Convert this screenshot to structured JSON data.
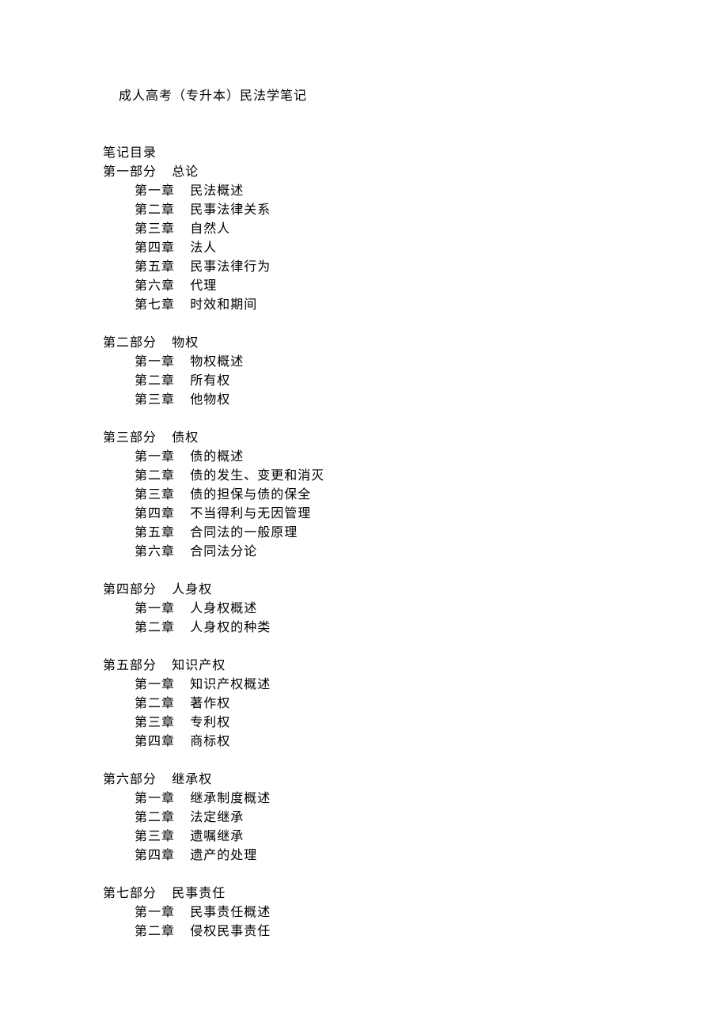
{
  "title": "成人高考（专升本）民法学笔记",
  "toc_header": "笔记目录",
  "parts": [
    {
      "label": "第一部分",
      "name": "总论",
      "chapters": [
        {
          "label": "第一章",
          "name": "民法概述"
        },
        {
          "label": "第二章",
          "name": "民事法律关系"
        },
        {
          "label": "第三章",
          "name": "自然人"
        },
        {
          "label": "第四章",
          "name": "法人"
        },
        {
          "label": "第五章",
          "name": "民事法律行为"
        },
        {
          "label": "第六章",
          "name": "代理"
        },
        {
          "label": "第七章",
          "name": "时效和期间"
        }
      ]
    },
    {
      "label": "第二部分",
      "name": "物权",
      "chapters": [
        {
          "label": "第一章",
          "name": "物权概述"
        },
        {
          "label": "第二章",
          "name": "所有权"
        },
        {
          "label": "第三章",
          "name": "他物权"
        }
      ]
    },
    {
      "label": "第三部分",
      "name": "债权",
      "chapters": [
        {
          "label": "第一章",
          "name": "债的概述"
        },
        {
          "label": "第二章",
          "name": "债的发生、变更和消灭"
        },
        {
          "label": "第三章",
          "name": "债的担保与债的保全"
        },
        {
          "label": "第四章",
          "name": "不当得利与无因管理"
        },
        {
          "label": "第五章",
          "name": "合同法的一般原理"
        },
        {
          "label": "第六章",
          "name": "合同法分论"
        }
      ]
    },
    {
      "label": "第四部分",
      "name": "人身权",
      "chapters": [
        {
          "label": "第一章",
          "name": "人身权概述"
        },
        {
          "label": "第二章",
          "name": "人身权的种类"
        }
      ]
    },
    {
      "label": "第五部分",
      "name": "知识产权",
      "chapters": [
        {
          "label": "第一章",
          "name": "知识产权概述"
        },
        {
          "label": "第二章",
          "name": "著作权"
        },
        {
          "label": "第三章",
          "name": "专利权"
        },
        {
          "label": "第四章",
          "name": "商标权"
        }
      ]
    },
    {
      "label": "第六部分",
      "name": "继承权",
      "chapters": [
        {
          "label": "第一章",
          "name": "继承制度概述"
        },
        {
          "label": "第二章",
          "name": "法定继承"
        },
        {
          "label": "第三章",
          "name": "遗嘱继承"
        },
        {
          "label": "第四章",
          "name": "遗产的处理"
        }
      ]
    },
    {
      "label": "第七部分",
      "name": "民事责任",
      "chapters": [
        {
          "label": "第一章",
          "name": "民事责任概述"
        },
        {
          "label": "第二章",
          "name": "侵权民事责任"
        }
      ]
    }
  ]
}
